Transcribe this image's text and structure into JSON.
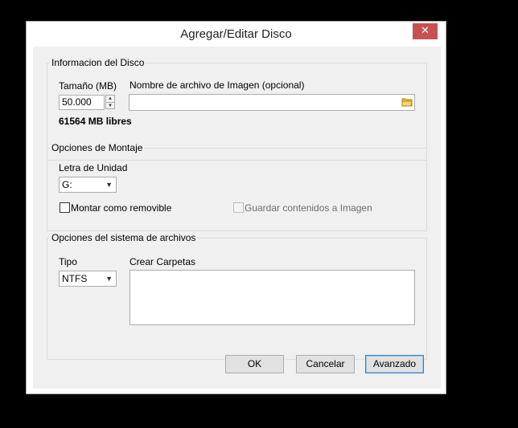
{
  "window": {
    "title": "Agregar/Editar Disco",
    "close_glyph": "✕"
  },
  "disk_info": {
    "legend": "Informacion del Disco",
    "size_label": "Tamaño (MB)",
    "size_value": "50.000",
    "image_label": "Nombre de archivo de Imagen (opcional)",
    "image_value": "",
    "free_text": "61564 MB libres"
  },
  "mount_options": {
    "legend": "Opciones de Montaje",
    "drive_label": "Letra de Unidad",
    "drive_value": "G:",
    "removable_label": "Montar como removible",
    "removable_checked": false,
    "save_label": "Guardar contenidos a Imagen",
    "save_enabled": false
  },
  "fs_options": {
    "legend": "Opciones del sistema de archivos",
    "type_label": "Tipo",
    "type_value": "NTFS",
    "folders_label": "Crear Carpetas",
    "folders_value": ""
  },
  "buttons": {
    "ok": "OK",
    "cancel": "Cancelar",
    "advanced": "Avanzado"
  },
  "icons": {
    "spin_up": "▲",
    "spin_down": "▼",
    "dropdown": "▼",
    "folder": "folder-icon"
  },
  "colors": {
    "close_bg": "#c75050",
    "dialog_bg": "#f0f0f0",
    "default_button_border": "#3c7fb1"
  }
}
